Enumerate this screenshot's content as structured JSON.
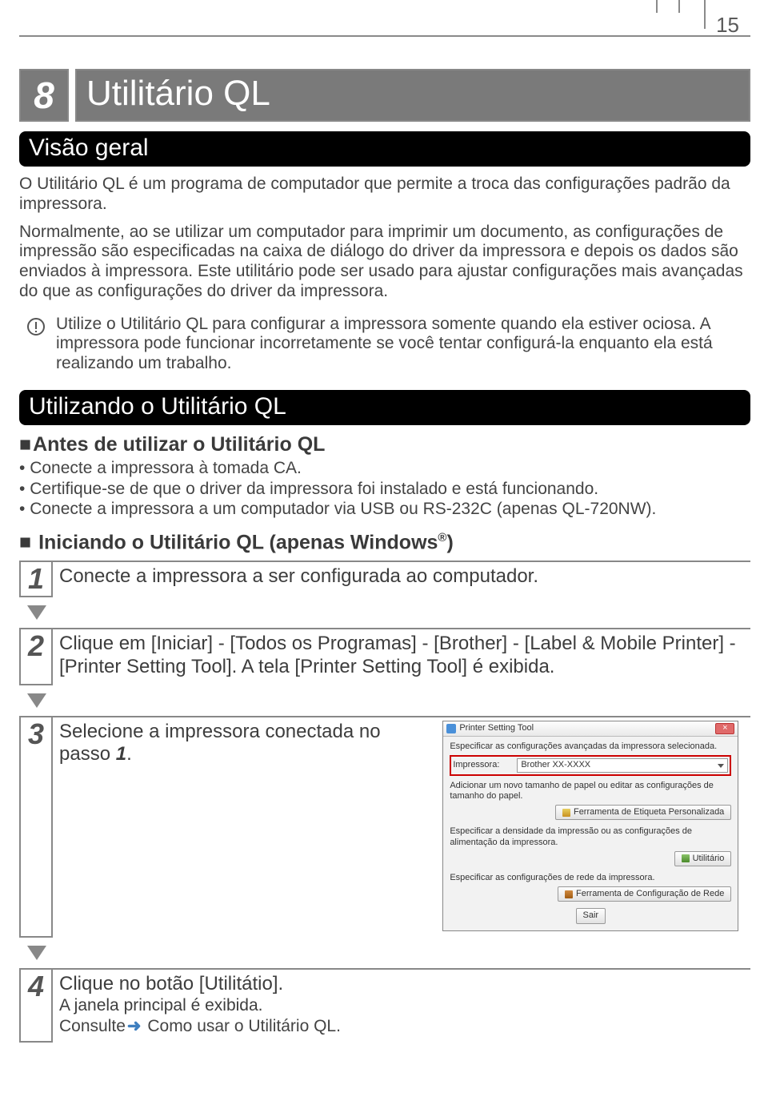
{
  "page_number": "15",
  "chapter_number": "8",
  "chapter_title": "Utilitário QL",
  "section1_title": "Visão geral",
  "intro1": "O Utilitário QL é um programa de computador que permite a troca das configurações padrão da impressora.",
  "intro2": "Normalmente, ao se utilizar um computador para imprimir um documento, as configurações de impressão são especificadas na caixa de diálogo do driver da impressora e depois os dados são enviados à impressora. Este utilitário pode ser usado para ajustar configurações mais avançadas do que as configurações do driver da impressora.",
  "note": "Utilize o Utilitário QL para configurar a impressora somente quando ela estiver ociosa. A impressora pode funcionar incorretamente se você tentar configurá-la enquanto ela está realizando um trabalho.",
  "section2_title": "Utilizando o Utilitário QL",
  "sub1": "Antes de utilizar o Utilitário QL",
  "before_items": [
    "Conecte a impressora à tomada CA.",
    "Certifique-se de que o driver da impressora foi instalado e está funcionando.",
    "Conecte a impressora a um computador via USB ou RS-232C (apenas QL-720NW)."
  ],
  "sub2_prefix": "Iniciando o Utilitário QL (apenas Windows",
  "sub2_suffix": ")",
  "steps": {
    "s1_num": "1",
    "s1_text": "Conecte a impressora a ser configurada ao computador.",
    "s2_num": "2",
    "s2_text": "Clique em [Iniciar] - [Todos os Programas] - [Brother] - [Label & Mobile Printer] - [Printer Setting Tool]. A tela [Printer Setting Tool] é exibida.",
    "s3_num": "3",
    "s3_text": "Selecione a impressora conectada no passo ",
    "s3_ref_num": "1",
    "s3_ref_suffix": ".",
    "s4_num": "4",
    "s4_text_a": "Clique no botão [Utilitátio].",
    "s4_text_b": "A janela principal é exibida.",
    "s4_text_c_prefix": "Consulte",
    "s4_text_c_link": "Como usar o Utilitário QL."
  },
  "dialog": {
    "title": "Printer Setting Tool",
    "line1": "Especificar as configurações avançadas da impressora selecionada.",
    "printer_label": "Impressora:",
    "printer_value": "Brother XX-XXXX",
    "line2": "Adicionar um novo tamanho de papel ou editar as configurações de tamanho do papel.",
    "btn_label_tool": "Ferramenta de Etiqueta Personalizada",
    "line3": "Especificar a densidade da impressão ou as configurações de alimentação da impressora.",
    "btn_util": "Utilitário",
    "line4": "Especificar as configurações de rede da impressora.",
    "btn_net": "Ferramenta de Configuração de Rede",
    "btn_exit": "Sair"
  }
}
